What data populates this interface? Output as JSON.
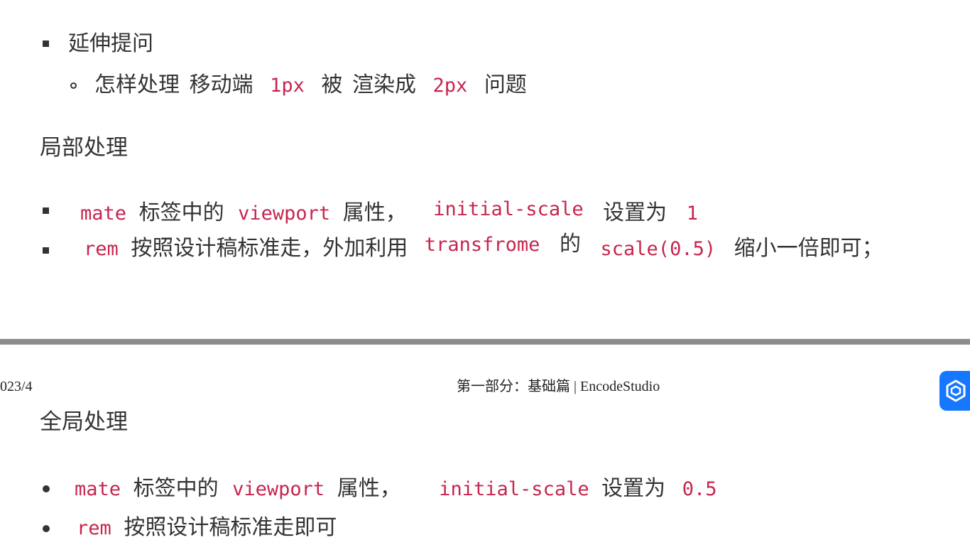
{
  "section1": {
    "bullet_title": "延伸提问",
    "sub": [
      "怎样处理",
      "移动端",
      "1px",
      "被",
      "渲染成",
      "2px",
      "问题"
    ]
  },
  "local": {
    "heading": "局部处理",
    "item1": [
      "mate",
      "标签中的",
      "viewport",
      "属性，",
      "initial-scale",
      "设置为",
      "1"
    ],
    "item2": [
      "rem",
      "按照设计稿标准走，外加利用",
      "transfrome",
      "的",
      "scale(0.5)",
      "缩小一倍即可；"
    ]
  },
  "footer": {
    "date": "023/4",
    "center": "第一部分：基础篇 |  EncodeStudio"
  },
  "badge": {
    "icon": "cube-logo-icon",
    "color": "#1677ff"
  },
  "global": {
    "heading": "全局处理",
    "item1": [
      "mate",
      "标签中的",
      "viewport",
      "属性，",
      "initial-scale",
      "设置为",
      "0.5"
    ],
    "item2": [
      "rem",
      "按照设计稿标准走即可"
    ]
  }
}
